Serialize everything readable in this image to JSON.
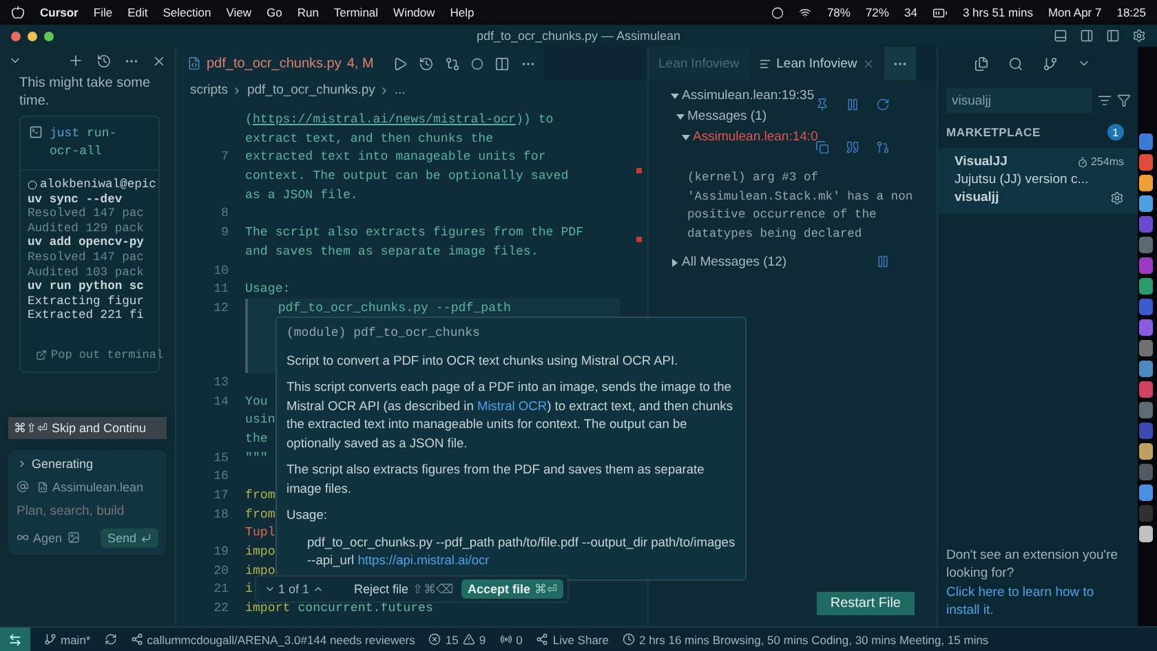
{
  "menubar": {
    "app": "Cursor",
    "menus": [
      "File",
      "Edit",
      "Selection",
      "View",
      "Go",
      "Run",
      "Terminal",
      "Window",
      "Help"
    ],
    "readings": [
      "78%",
      "72%",
      "34"
    ],
    "battery_time": "3 hrs 51 mins",
    "date": "Mon Apr 7",
    "time": "18:25"
  },
  "window": {
    "title": "pdf_to_ocr_chunks.py — Assimulean"
  },
  "chat": {
    "note": "This might take some time.",
    "command": "just",
    "args": "run-ocr-all",
    "terminal": [
      {
        "kind": "prompt",
        "text": "alokbeniwal@epic"
      },
      {
        "kind": "command",
        "text": "uv sync --dev"
      },
      {
        "kind": "dim",
        "text": "Resolved 147 pac"
      },
      {
        "kind": "dim",
        "text": "Audited 129 pack"
      },
      {
        "kind": "command",
        "text": "uv add opencv-py"
      },
      {
        "kind": "dim",
        "text": "Resolved 147 pac"
      },
      {
        "kind": "dim",
        "text": "Audited 103 pack"
      },
      {
        "kind": "command",
        "text": "uv run python sc"
      },
      {
        "kind": "output",
        "text": "Extracting figur"
      },
      {
        "kind": "output",
        "text": "Extracted 221 fi"
      }
    ],
    "popout": "Pop out terminal",
    "skip_keys": "⌘⇧⏎",
    "skip": "Skip and Continu",
    "composer": {
      "status": "Generating",
      "context_file": "Assimulean.lean",
      "placeholder": "Plan, search, build",
      "mode": "Agen",
      "send": "Send"
    }
  },
  "editor": {
    "tab": {
      "name": "pdf_to_ocr_chunks.py",
      "badge": "4, M"
    },
    "breadcrumb": [
      "scripts",
      "pdf_to_ocr_chunks.py",
      "..."
    ],
    "lines": [
      {
        "kind": "text",
        "parts": [
          {
            "kind": "doc",
            "text": "("
          },
          {
            "kind": "link",
            "text": "https://mistral.ai/news/mistral-ocr"
          },
          {
            "kind": "doc",
            "text": ")) to"
          }
        ]
      },
      {
        "kind": "text",
        "parts": [
          {
            "kind": "doc",
            "text": "extract text, and then chunks the"
          }
        ]
      },
      {
        "kind": "text",
        "number": "7",
        "parts": [
          {
            "kind": "doc",
            "text": "extracted text into manageable units for"
          }
        ]
      },
      {
        "kind": "text",
        "parts": [
          {
            "kind": "doc",
            "text": "context. The output can be optionally saved"
          }
        ]
      },
      {
        "kind": "text",
        "parts": [
          {
            "kind": "doc",
            "text": "as a JSON file."
          }
        ]
      },
      {
        "kind": "text",
        "number": "8"
      },
      {
        "kind": "text",
        "number": "9",
        "parts": [
          {
            "kind": "doc",
            "text": "The script also extracts figures from the PDF"
          }
        ]
      },
      {
        "kind": "text",
        "parts": [
          {
            "kind": "doc",
            "text": "and saves them as separate image files."
          }
        ]
      },
      {
        "kind": "text",
        "number": "10"
      },
      {
        "kind": "text",
        "number": "11",
        "parts": [
          {
            "kind": "doc",
            "text": "Usage:"
          }
        ]
      },
      {
        "kind": "usage",
        "number": "12",
        "parts": [
          {
            "kind": "doc",
            "text": "    pdf_to_ocr_chunks.py --pdf_path"
          }
        ]
      },
      {
        "kind": "text",
        "number": "13"
      },
      {
        "kind": "text",
        "number": "14",
        "parts": [
          {
            "kind": "doc",
            "text": "You"
          }
        ]
      },
      {
        "kind": "text",
        "parts": [
          {
            "kind": "doc",
            "text": "usin"
          }
        ]
      },
      {
        "kind": "text",
        "parts": [
          {
            "kind": "doc",
            "text": "the"
          }
        ]
      },
      {
        "kind": "text",
        "number": "15",
        "parts": [
          {
            "kind": "doc",
            "text": "\"\"\""
          }
        ]
      },
      {
        "kind": "text",
        "number": "16"
      },
      {
        "kind": "text",
        "number": "17",
        "parts": [
          {
            "kind": "keyword",
            "text": "from"
          }
        ]
      },
      {
        "kind": "text",
        "number": "18",
        "parts": [
          {
            "kind": "keyword",
            "text": "from"
          }
        ]
      },
      {
        "kind": "text",
        "parts": [
          {
            "kind": "type",
            "text": "Tupl"
          }
        ]
      },
      {
        "kind": "text",
        "number": "19",
        "parts": [
          {
            "kind": "keyword",
            "text": "impo"
          }
        ]
      },
      {
        "kind": "text",
        "number": "20",
        "parts": [
          {
            "kind": "keyword",
            "text": "impo"
          }
        ]
      },
      {
        "kind": "text",
        "number": "21",
        "parts": [
          {
            "kind": "keyword",
            "text": "i"
          }
        ]
      },
      {
        "kind": "text",
        "number": "22",
        "parts": [
          {
            "kind": "keyword",
            "text": "import"
          },
          {
            "kind": "plain",
            "text": " concurrent.futures"
          }
        ]
      }
    ],
    "hover": {
      "signature": "(module) pdf_to_ocr_chunks",
      "paragraphs": [
        [
          {
            "kind": "text",
            "text": "Script to convert a PDF into OCR text chunks using Mistral OCR API."
          }
        ],
        [
          {
            "kind": "text",
            "text": "This script converts each page of a PDF into an image, sends the image to the Mistral OCR API (as described in "
          },
          {
            "kind": "link",
            "text": "Mistral OCR"
          },
          {
            "kind": "text",
            "text": ") to extract text, and then chunks the extracted text into manageable units for context. The output can be optionally saved as a JSON file."
          }
        ],
        [
          {
            "kind": "text",
            "text": "The script also extracts figures from the PDF and saves them as separate image files."
          }
        ],
        [
          {
            "kind": "text",
            "text": "Usage:"
          }
        ]
      ],
      "usage": [
        {
          "kind": "text",
          "text": "pdf_to_ocr_chunks.py --pdf_path path/to/file.pdf --output_dir path/to/images --api_url "
        },
        {
          "kind": "link",
          "text": "https://api.mistral.ai/ocr"
        }
      ]
    },
    "review": {
      "counter": "1 of 1",
      "reject": "Reject file",
      "reject_keys": "⇧⌘⌫",
      "accept": "Accept file",
      "accept_keys": "⌘⏎"
    }
  },
  "infoview": {
    "tabs": [
      {
        "label": "Lean Infoview",
        "selected": false
      },
      {
        "label": "Lean Infoview",
        "selected": true
      }
    ],
    "goal": {
      "label": "Assimulean.lean:19:35",
      "expanded": true
    },
    "messages": {
      "label": "Messages (1)",
      "expanded": true
    },
    "message": {
      "location": "Assimulean.lean:14:0",
      "expanded": true,
      "text": "(kernel) arg #3 of 'Assimulean.Stack.mk' has a non positive occurrence of the datatypes being declared"
    },
    "all_messages": {
      "label": "All Messages (12)",
      "expanded": false
    },
    "restart": "Restart File"
  },
  "extensions": {
    "search": "visualjj",
    "section": "MARKETPLACE",
    "count": "1",
    "item": {
      "name": "VisualJJ",
      "time": "254ms",
      "description": "Jujutsu (JJ) version c...",
      "publisher": "visualjj"
    },
    "footer": "Don't see an extension you're looking for?",
    "footer_link": "Click here to learn how to install it."
  },
  "status_bar": {
    "branch": "main*",
    "pr": "callummcdougall/ARENA_3.0#144 needs reviewers",
    "errors": "15",
    "warnings": "9",
    "ports": "0",
    "live_share": "Live Share",
    "activity": "2 hrs 16 mins Browsing, 50 mins Coding, 30 mins Meeting, 15 mins"
  }
}
